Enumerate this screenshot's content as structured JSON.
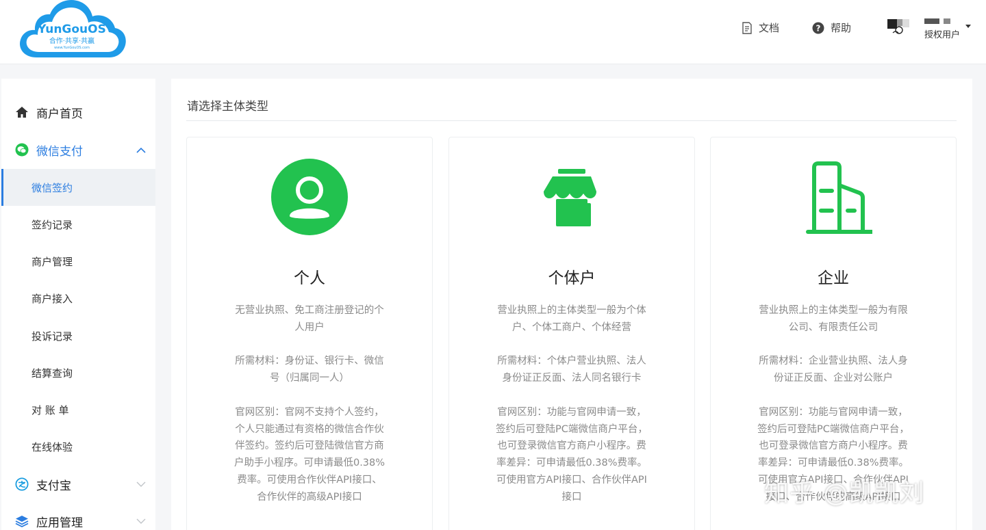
{
  "header": {
    "logo": {
      "brand": "YunGouOS",
      "slogan": "合作·共享·共赢",
      "site": "www.YunGouOS.com"
    },
    "docs_label": "文档",
    "help_label": "帮助",
    "user_label": "授权用户"
  },
  "sidebar": {
    "items": [
      {
        "label": "商户首页",
        "icon": "home-icon"
      },
      {
        "label": "微信支付",
        "icon": "wechat-icon",
        "expanded": true,
        "children": [
          {
            "label": "微信签约",
            "active": true
          },
          {
            "label": "签约记录"
          },
          {
            "label": "商户管理"
          },
          {
            "label": "商户接入"
          },
          {
            "label": "投诉记录"
          },
          {
            "label": "结算查询"
          },
          {
            "label": "对 账 单"
          },
          {
            "label": "在线体验"
          }
        ]
      },
      {
        "label": "支付宝",
        "icon": "alipay-icon",
        "expanded": false
      },
      {
        "label": "应用管理",
        "icon": "layers-icon",
        "expanded": false
      }
    ]
  },
  "main": {
    "title": "请选择主体类型",
    "cards": [
      {
        "title": "个人",
        "icon": "person-icon",
        "lines": [
          "无营业执照、免工商注册登记的个人用户",
          "所需材料：身份证、银行卡、微信号（归属同一人）",
          "官网区别：官网不支持个人签约，个人只能通过有资格的微信合作伙伴签约。签约后可登陆微信官方商户助手小程序。可申请最低0.38%费率。可使用合作伙伴API接口、合作伙伴的高级API接口"
        ]
      },
      {
        "title": "个体户",
        "icon": "store-icon",
        "lines": [
          "营业执照上的主体类型一般为个体户、个体工商户、个体经营",
          "所需材料：个体户营业执照、法人身份证正反面、法人同名银行卡",
          "官网区别：功能与官网申请一致，签约后可登陆PC端微信商户平台，也可登录微信官方商户小程序。费率差异：可申请最低0.38%费率。可使用官方API接口、合作伙伴API接口"
        ]
      },
      {
        "title": "企业",
        "icon": "building-icon",
        "lines": [
          "营业执照上的主体类型一般为有限公司、有限责任公司",
          "所需材料：企业营业执照、法人身份证正反面、企业对公账户",
          "官网区别：功能与官网申请一致，签约后可登陆PC端微信商户平台，也可登录微信官方商户小程序。费率差异：可申请最低0.38%费率。可使用官方API接口、合作伙伴API接口、合作伙伴的高级API接口"
        ]
      }
    ]
  },
  "watermark": "知乎 @凯凯刘",
  "colors": {
    "accent": "#2b7de0",
    "green": "#22c24f",
    "logo_blue": "#1f9be8"
  }
}
